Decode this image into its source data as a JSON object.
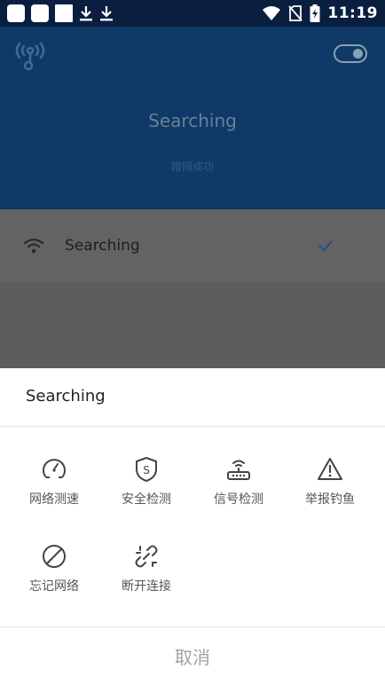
{
  "status_bar": {
    "time": "11:19",
    "left_icons": [
      "app-notification-icon",
      "app-notification-icon",
      "square-notification-icon",
      "download-icon",
      "download-icon"
    ],
    "right_icons": [
      "wifi-signal-icon",
      "no-sim-icon",
      "battery-charging-icon"
    ]
  },
  "header": {
    "title": "Searching",
    "subtitle": "蹭网成功",
    "router_icon": "router-icon",
    "toggle_icon": "toggle-switch"
  },
  "network_row": {
    "ssid": "Searching",
    "icons": [
      "wifi-icon",
      "check-icon"
    ]
  },
  "sheet": {
    "title": "Searching",
    "actions": [
      {
        "label": "网络测速",
        "icon": "speedometer-icon"
      },
      {
        "label": "安全检测",
        "icon": "shield-icon"
      },
      {
        "label": "信号检测",
        "icon": "router-signal-icon"
      },
      {
        "label": "举报钓鱼",
        "icon": "warning-icon"
      },
      {
        "label": "忘记网络",
        "icon": "forbidden-icon"
      },
      {
        "label": "断开连接",
        "icon": "broken-link-icon"
      }
    ],
    "cancel_label": "取消"
  },
  "colors": {
    "status_bar_bg": "#0a1f3f",
    "header_bg": "#0f3a67",
    "overlay_bg": "#5d5d5d",
    "accent_check": "#2a4f86"
  }
}
